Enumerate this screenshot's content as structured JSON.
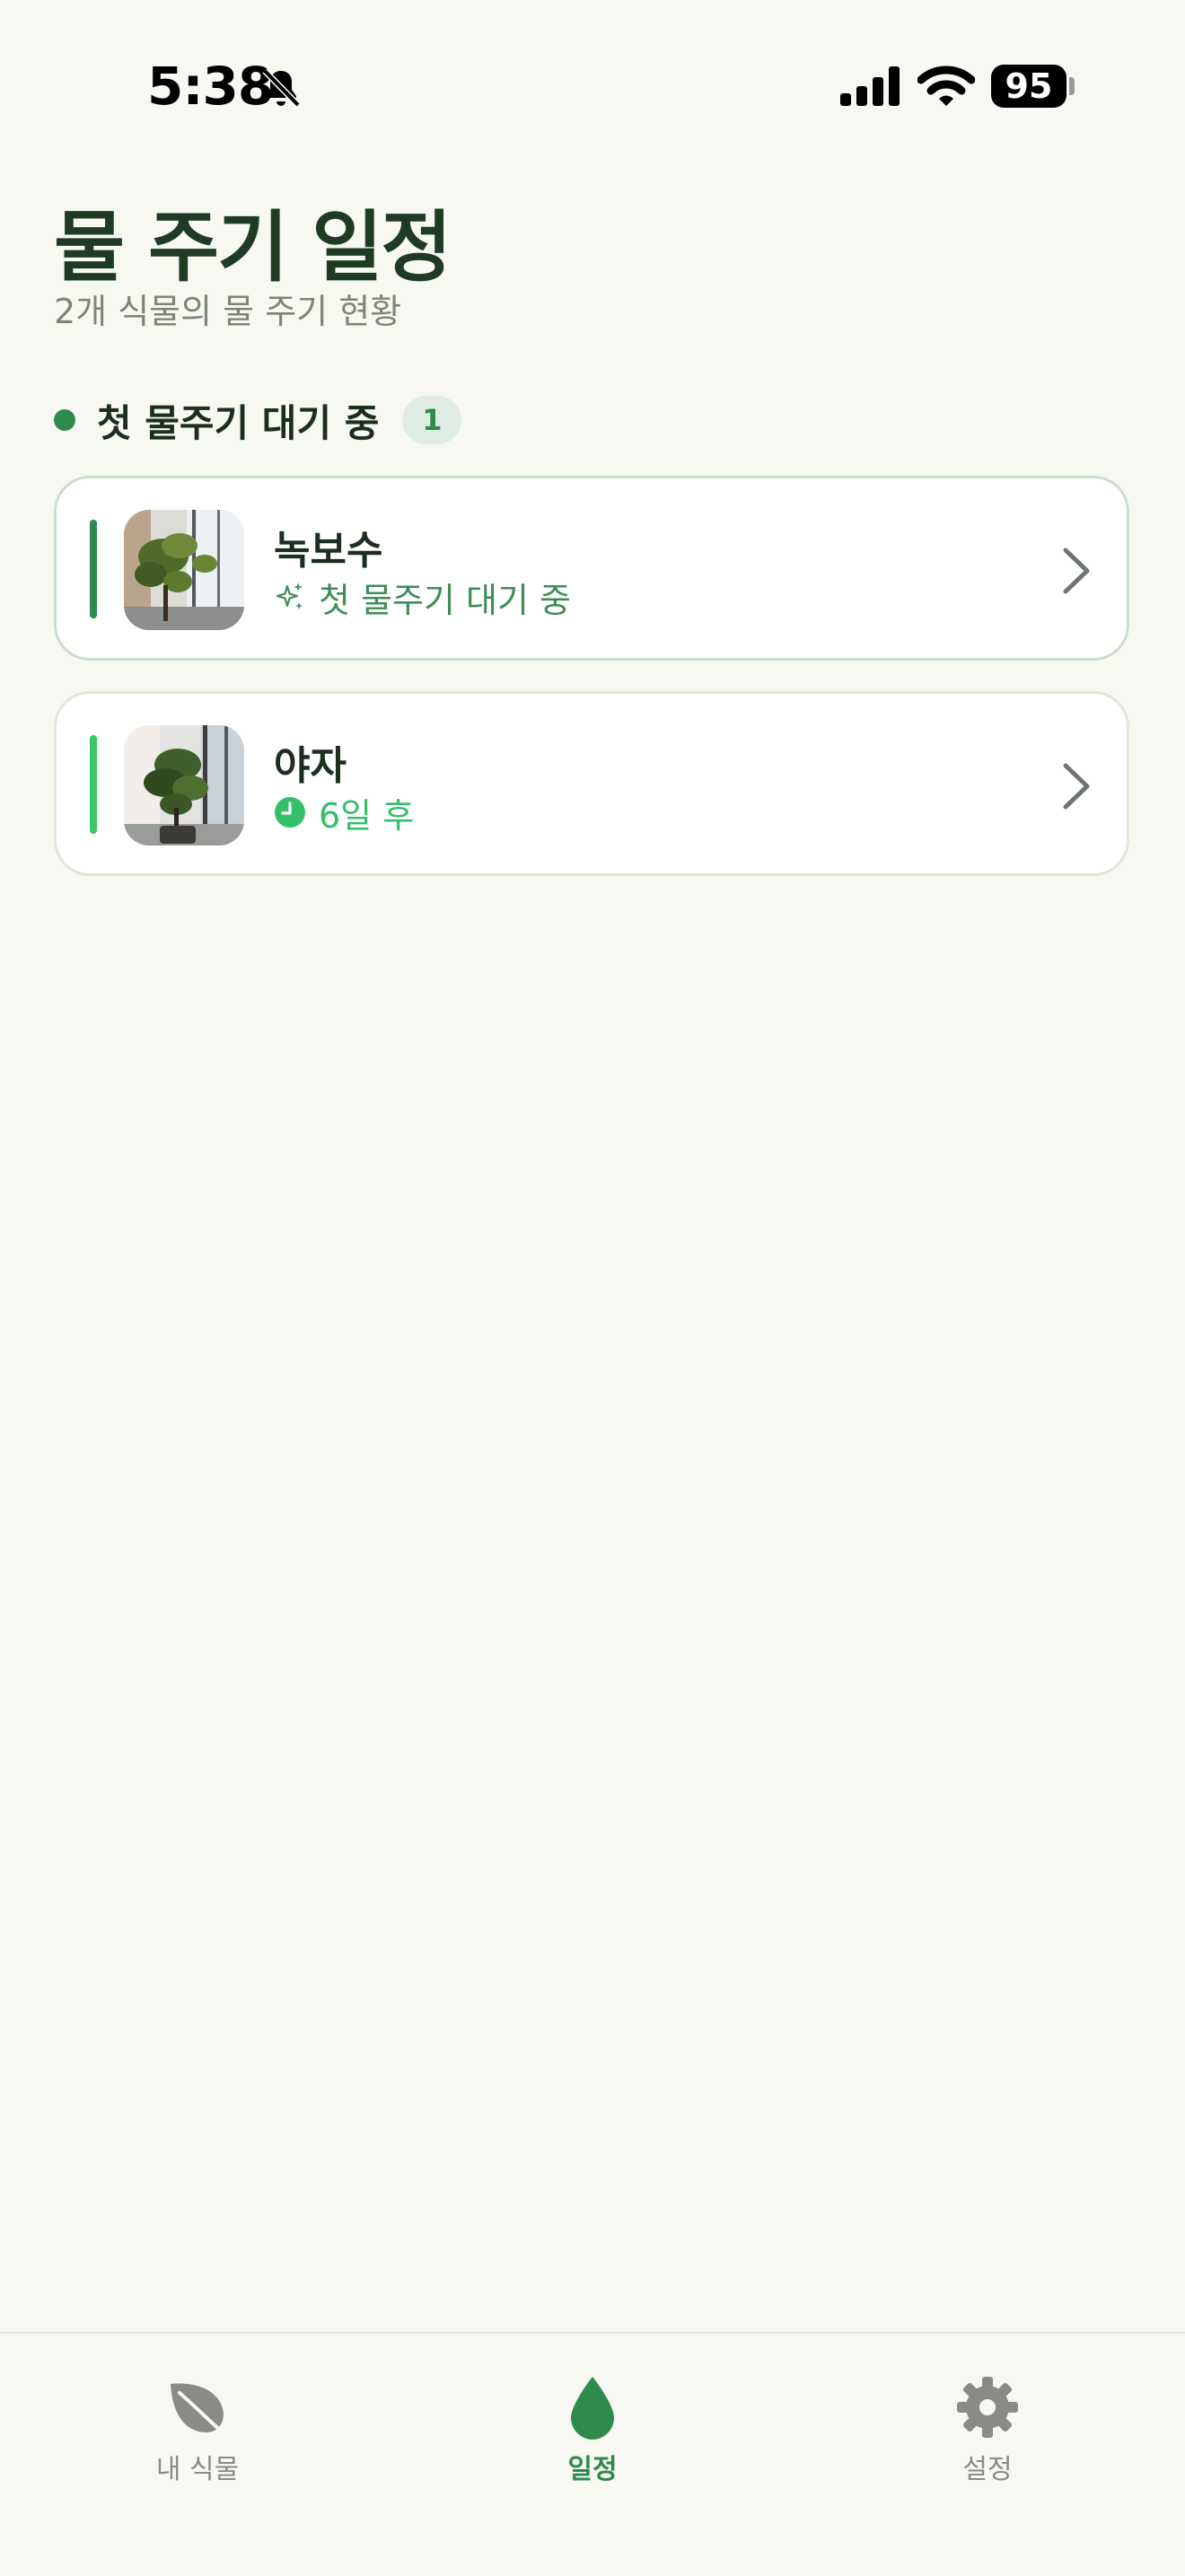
{
  "status_bar": {
    "time": "5:38",
    "battery": "95"
  },
  "header": {
    "title": "물 주기 일정",
    "subtitle": "2개 식물의 물 주기 현황"
  },
  "section": {
    "title": "첫 물주기 대기 중",
    "count": "1"
  },
  "plants": [
    {
      "name": "녹보수",
      "status": "첫 물주기 대기 중",
      "status_icon": "sparkles-icon",
      "status_color": "#3d8e56"
    },
    {
      "name": "야자",
      "status": "6일 후",
      "status_icon": "clock-icon",
      "status_color": "#34c06a"
    }
  ],
  "tab_bar": {
    "tabs": [
      {
        "label": "내 식물",
        "icon": "leaf-icon",
        "active": false
      },
      {
        "label": "일정",
        "icon": "water-drop-icon",
        "active": true
      },
      {
        "label": "설정",
        "icon": "gear-icon",
        "active": false
      }
    ]
  },
  "colors": {
    "accent": "#2e8a4d",
    "accent_light": "#3ec766",
    "background": "#f8f8f3",
    "title": "#1f3b24",
    "muted": "#7d8579"
  }
}
